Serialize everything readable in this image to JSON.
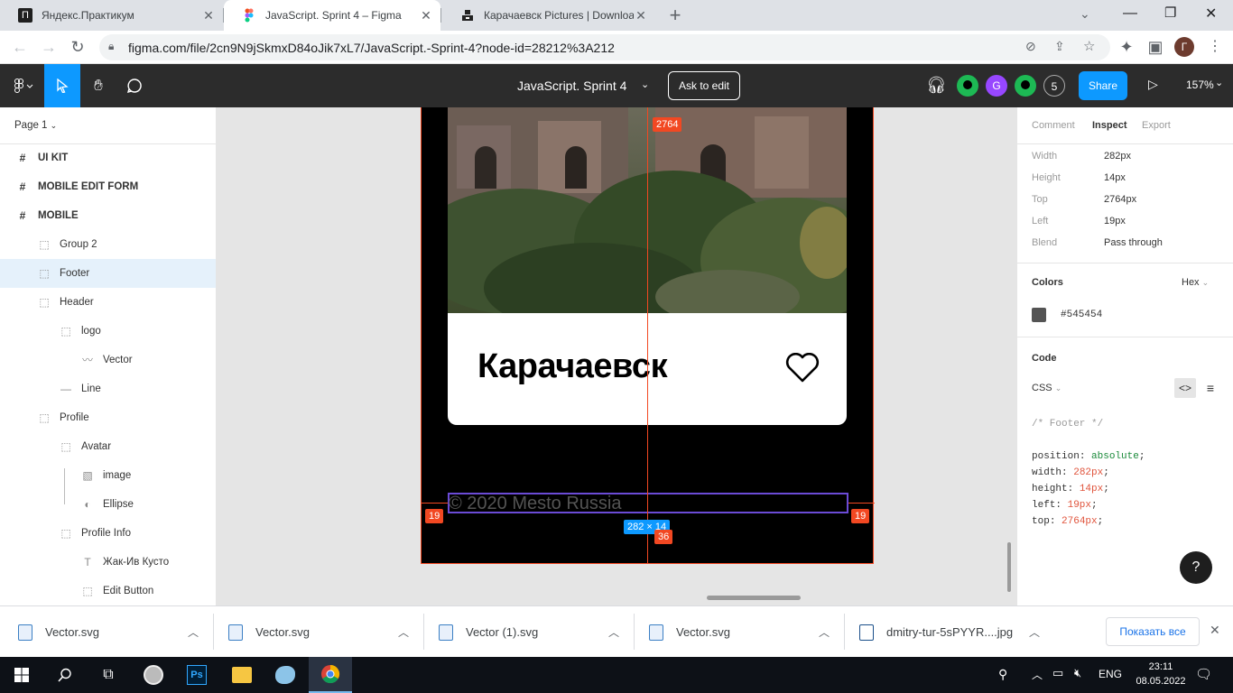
{
  "browser": {
    "tabs": [
      {
        "title": "Яндекс.Практикум",
        "favicon": "practicum-icon"
      },
      {
        "title": "JavaScript. Sprint 4 – Figma",
        "favicon": "figma-icon",
        "active": true
      },
      {
        "title": "Карачаевск Pictures | Download",
        "favicon": "unsplash-icon"
      }
    ],
    "new_tab": "+",
    "url": "figma.com/file/2cn9N9jSkmxD84oJik7xL7/JavaScript.-Sprint-4?node-id=28212%3A212",
    "profile_initial": "Г"
  },
  "figma": {
    "file_title": "JavaScript. Sprint 4",
    "ask_to_edit": "Ask to edit",
    "avatars": [
      {
        "initial": "",
        "color": "#1db954"
      },
      {
        "initial": "G",
        "color": "#9747ff"
      },
      {
        "initial": "",
        "color": "#1db954"
      },
      {
        "initial": "5",
        "color": "#2c2c2c"
      }
    ],
    "share": "Share",
    "zoom": "157%",
    "page": "Page 1",
    "layers": [
      {
        "label": "UI KIT",
        "icon": "#",
        "indent": 0,
        "bold": true
      },
      {
        "label": "MOBILE EDIT FORM",
        "icon": "#",
        "indent": 0,
        "bold": true
      },
      {
        "label": "MOBILE",
        "icon": "#",
        "indent": 0,
        "bold": true
      },
      {
        "label": "Group 2",
        "icon": "⬚",
        "indent": 1
      },
      {
        "label": "Footer",
        "icon": "⬚",
        "indent": 1,
        "selected": true
      },
      {
        "label": "Header",
        "icon": "⬚",
        "indent": 1
      },
      {
        "label": "logo",
        "icon": "⬚",
        "indent": 2
      },
      {
        "label": "Vector",
        "icon": "〰",
        "indent": 3
      },
      {
        "label": "Line",
        "icon": "—",
        "indent": 2
      },
      {
        "label": "Profile",
        "icon": "⬚",
        "indent": 1
      },
      {
        "label": "Avatar",
        "icon": "⬚",
        "indent": 2
      },
      {
        "label": "image",
        "icon": "▧",
        "indent": 3
      },
      {
        "label": "Ellipse",
        "icon": "◐",
        "indent": 3
      },
      {
        "label": "Profile Info",
        "icon": "⬚",
        "indent": 2
      },
      {
        "label": "Жак-Ив Кусто",
        "icon": "T",
        "indent": 3
      },
      {
        "label": "Edit Button",
        "icon": "⬚",
        "indent": 3
      }
    ],
    "canvas": {
      "card_title": "Карачаевск",
      "footer_text": "© 2020 Mesto Russia",
      "measure_top": "2764",
      "measure_left": "19",
      "measure_right": "19",
      "measure_bottom": "36",
      "size_label": "282 × 14"
    },
    "inspect": {
      "tabs": [
        "Comment",
        "Inspect",
        "Export"
      ],
      "active_tab": "Inspect",
      "props": [
        {
          "label": "Width",
          "value": "282px"
        },
        {
          "label": "Height",
          "value": "14px"
        },
        {
          "label": "Top",
          "value": "2764px"
        },
        {
          "label": "Left",
          "value": "19px"
        },
        {
          "label": "Blend",
          "value": "Pass through"
        }
      ],
      "colors_title": "Colors",
      "color_format": "Hex",
      "color_hex": "#545454",
      "code_title": "Code",
      "code_lang": "CSS",
      "code_comment": "/* Footer */",
      "code_lines": [
        {
          "prop": "position",
          "value": "absolute",
          "color": "#1a8a3a"
        },
        {
          "prop": "width",
          "value": "282px",
          "color": "#e0533b"
        },
        {
          "prop": "height",
          "value": "14px",
          "color": "#e0533b"
        },
        {
          "prop": "left",
          "value": "19px",
          "color": "#e0533b"
        },
        {
          "prop": "top",
          "value": "2764px",
          "color": "#e0533b"
        }
      ],
      "help": "?"
    }
  },
  "downloads": {
    "items": [
      "Vector.svg",
      "Vector.svg",
      "Vector (1).svg",
      "Vector.svg",
      "dmitry-tur-5sPYYR....jpg"
    ],
    "show_all": "Показать все"
  },
  "taskbar": {
    "lang": "ENG",
    "time": "23:11",
    "date": "08.05.2022"
  }
}
